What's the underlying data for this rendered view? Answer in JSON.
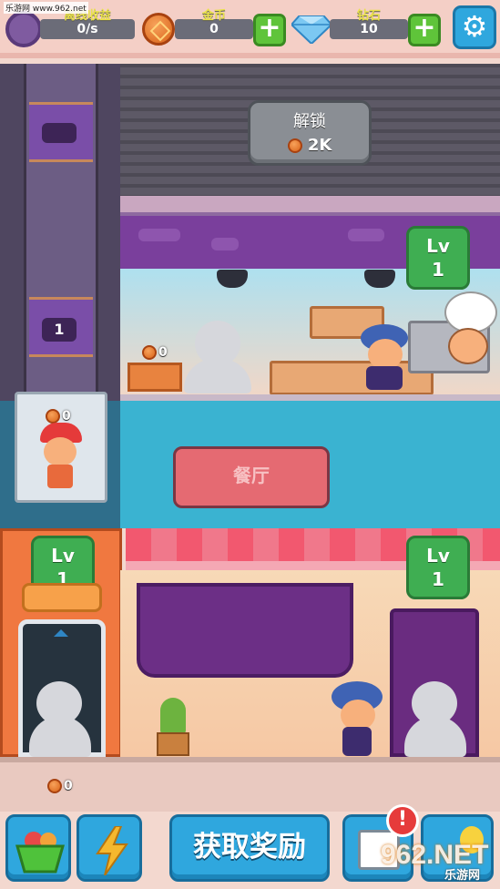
{
  "watermark": "乐游网 www.962.net",
  "hud": {
    "income_label": "离线收益",
    "income_value": "0/s",
    "coins_label": "金币",
    "coins_value": "0",
    "gems_label": "钻石",
    "gems_value": "10",
    "plus_symbol": "+",
    "settings_icon": "gear-icon"
  },
  "locked_floor": {
    "title": "解锁",
    "cost": "2K"
  },
  "shaft": {
    "floor_number": "1",
    "box_coins": "0"
  },
  "kitchen": {
    "level_label": "Lv",
    "level_value": "1",
    "box_coins": "0"
  },
  "restaurant": {
    "sign": "餐厅",
    "level_label": "Lv",
    "level_value": "1"
  },
  "elevator_car": {
    "coins": "0"
  },
  "left_station": {
    "level_label": "Lv",
    "level_value": "1"
  },
  "ground": {
    "coins": "0"
  },
  "bottom": {
    "reward_button": "获取奖励",
    "alert": "!",
    "watermark_big": "962.NET",
    "watermark_small": "乐游网"
  },
  "colors": {
    "accent_blue": "#2fa7de",
    "accent_green": "#3fae52",
    "coin_orange": "#d96318",
    "awning_red": "#f2586f"
  }
}
